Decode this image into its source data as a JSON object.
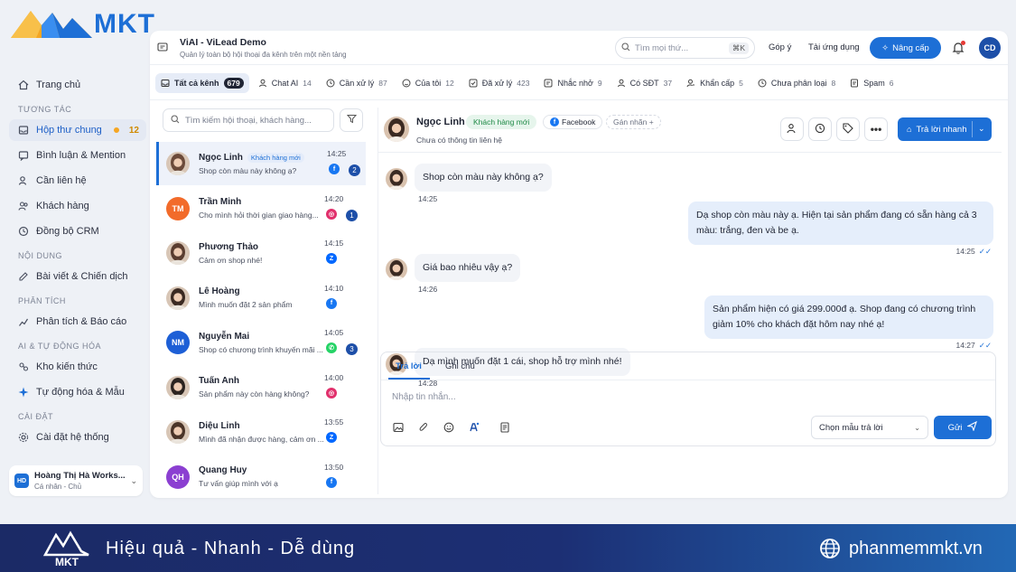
{
  "brand": {
    "name": "MKT",
    "slogan": "Hiệu quả - Nhanh - Dễ dùng",
    "website": "phanmemmkt.vn",
    "accent": "#1d6fd6"
  },
  "sidebar": {
    "home": "Trang chủ",
    "sections": [
      {
        "title": "TƯƠNG TÁC",
        "items": [
          {
            "label": "Hộp thư chung",
            "badge": "12",
            "active": true,
            "icon": "inbox-icon"
          },
          {
            "label": "Bình luận & Mention",
            "icon": "comment-icon"
          },
          {
            "label": "Cần liên hệ",
            "icon": "contact-icon"
          },
          {
            "label": "Khách hàng",
            "icon": "users-icon"
          },
          {
            "label": "Đồng bộ CRM",
            "icon": "sync-icon"
          }
        ]
      },
      {
        "title": "NỘI DUNG",
        "items": [
          {
            "label": "Bài viết & Chiến dịch",
            "icon": "post-icon"
          }
        ]
      },
      {
        "title": "PHÂN TÍCH",
        "items": [
          {
            "label": "Phân tích & Báo cáo",
            "icon": "chart-icon"
          }
        ]
      },
      {
        "title": "AI & TỰ ĐỘNG HÓA",
        "items": [
          {
            "label": "Kho kiến thức",
            "icon": "knowledge-icon"
          },
          {
            "label": "Tự động hóa & Mẫu",
            "icon": "sparkle-icon"
          }
        ]
      },
      {
        "title": "CÀI ĐẶT",
        "items": [
          {
            "label": "Cài đặt hệ thống",
            "icon": "gear-icon"
          }
        ]
      }
    ],
    "user": {
      "initials": "HD",
      "name": "Hoàng Thị Hà Works...",
      "role": "Cá nhân - Chủ"
    }
  },
  "header": {
    "title": "ViAI - ViLead Demo",
    "subtitle": "Quản lý toàn bộ hội thoại đa kênh trên một nền tảng",
    "search_placeholder": "Tìm mọi thứ...",
    "shortcut": "⌘K",
    "feedback": "Góp ý",
    "download": "Tải ứng dụng",
    "upgrade": "Nâng cấp",
    "avatar": "CD"
  },
  "tabs": [
    {
      "label": "Tất cả kênh",
      "count": "679",
      "active": true
    },
    {
      "label": "Chat AI",
      "count": "14"
    },
    {
      "label": "Cần xử lý",
      "count": "87"
    },
    {
      "label": "Của tôi",
      "count": "12"
    },
    {
      "label": "Đã xử lý",
      "count": "423"
    },
    {
      "label": "Nhắc nhở",
      "count": "9"
    },
    {
      "label": "Có SĐT",
      "count": "37"
    },
    {
      "label": "Khẩn cấp",
      "count": "5"
    },
    {
      "label": "Chưa phân loại",
      "count": "8"
    },
    {
      "label": "Spam",
      "count": "6"
    }
  ],
  "conversations": {
    "search_placeholder": "Tìm kiếm hội thoại, khách hàng...",
    "items": [
      {
        "name": "Ngọc Linh",
        "tag": "Khách hàng mới",
        "preview": "Shop còn màu này không ạ?",
        "time": "14:25",
        "channel": "facebook",
        "unread": "2",
        "initials": "",
        "avatar_color": "#6b4a3a"
      },
      {
        "name": "Trần Minh",
        "tag": "",
        "preview": "Cho mình hỏi thời gian giao hàng...",
        "time": "14:20",
        "channel": "instagram",
        "unread": "1",
        "initials": "TM",
        "avatar_color": "#f26b2a"
      },
      {
        "name": "Phương Thảo",
        "tag": "",
        "preview": "Cảm ơn shop nhé!",
        "time": "14:15",
        "channel": "zalo",
        "unread": "",
        "initials": "",
        "avatar_color": "#5a3d30"
      },
      {
        "name": "Lê Hoàng",
        "tag": "",
        "preview": "Mình muốn đặt 2 sản phẩm",
        "time": "14:10",
        "channel": "facebook",
        "unread": "",
        "initials": "",
        "avatar_color": "#3b2a22"
      },
      {
        "name": "Nguyễn Mai",
        "tag": "",
        "preview": "Shop có chương trình khuyến mãi ...",
        "time": "14:05",
        "channel": "whatsapp",
        "unread": "3",
        "initials": "NM",
        "avatar_color": "#1d5fd6"
      },
      {
        "name": "Tuấn Anh",
        "tag": "",
        "preview": "Sản phẩm này còn hàng không?",
        "time": "14:00",
        "channel": "instagram",
        "unread": "",
        "initials": "",
        "avatar_color": "#2c2420"
      },
      {
        "name": "Diệu Linh",
        "tag": "",
        "preview": "Mình đã nhận được hàng, cảm ơn ...",
        "time": "13:55",
        "channel": "zalo",
        "unread": "",
        "initials": "",
        "avatar_color": "#4a3428"
      },
      {
        "name": "Quang Huy",
        "tag": "",
        "preview": "Tư vấn giúp mình với ạ",
        "time": "13:50",
        "channel": "facebook",
        "unread": "",
        "initials": "QH",
        "avatar_color": "#8b3fd1"
      }
    ]
  },
  "chat": {
    "name": "Ngọc Linh",
    "tag": "Khách hàng mới",
    "channel": "Facebook",
    "assign": "Gán nhãn",
    "status": "Chưa có thông tin liên hệ",
    "quick_reply": "Trả lời nhanh",
    "messages": [
      {
        "dir": "in",
        "text": "Shop còn màu này không ạ?",
        "time": "14:25"
      },
      {
        "dir": "out",
        "text": "Dạ shop còn màu này ạ. Hiện tại sản phẩm đang có sẵn hàng cả 3 màu: trắng, đen và be ạ.",
        "time": "14:25"
      },
      {
        "dir": "in",
        "text": "Giá bao nhiêu vậy ạ?",
        "time": "14:26"
      },
      {
        "dir": "out",
        "text": "Sản phẩm hiện có giá 299.000đ ạ. Shop đang có chương trình giảm 10% cho khách đặt hôm nay nhé ạ!",
        "time": "14:27"
      },
      {
        "dir": "in",
        "text": "Dạ mình muốn đặt 1 cái, shop hỗ trợ mình nhé!",
        "time": "14:28"
      }
    ],
    "composer": {
      "tab_reply": "Trả lời",
      "tab_note": "Ghi chú",
      "placeholder": "Nhập tin nhắn...",
      "template": "Chọn mẫu trả lời",
      "send": "Gửi"
    }
  }
}
